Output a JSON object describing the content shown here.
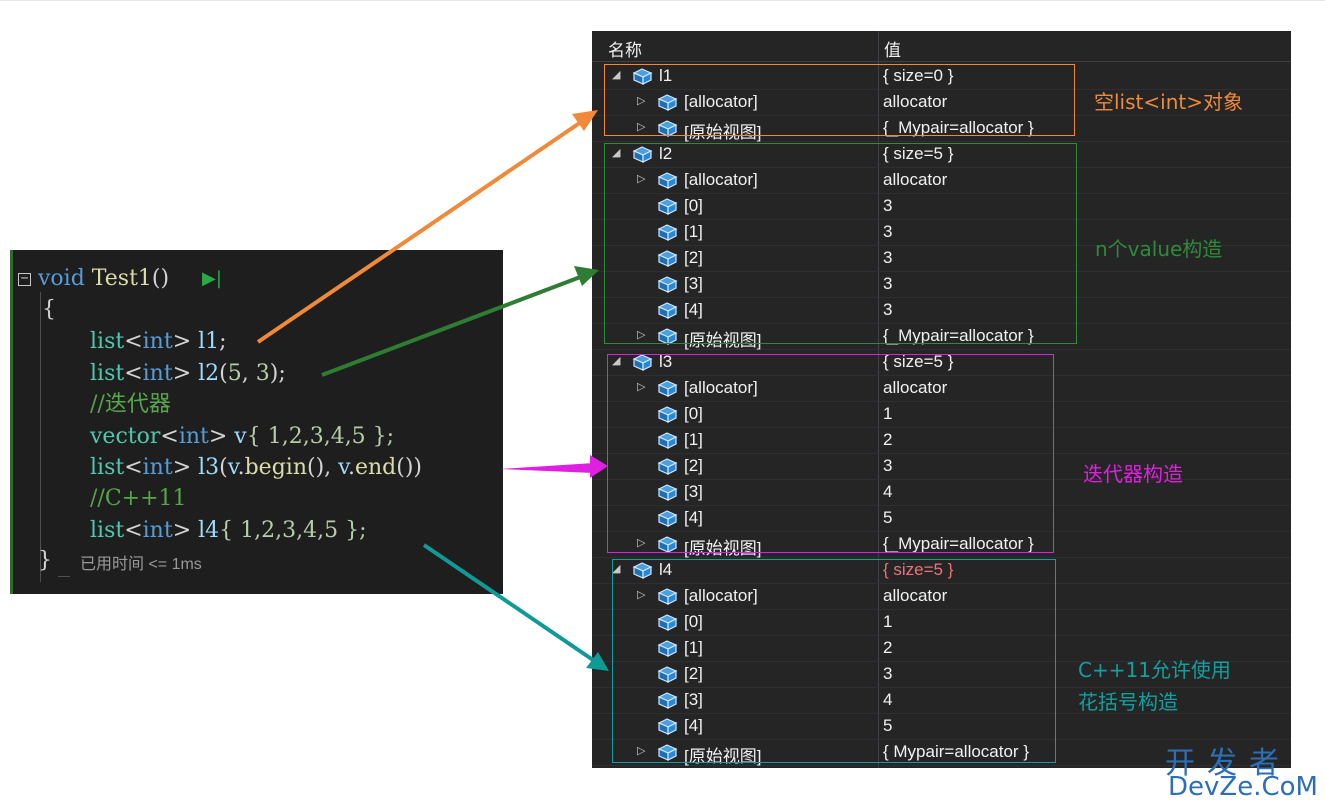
{
  "code": {
    "fold_symbol": "−",
    "line1": {
      "kw": "void",
      "fn": "Test1",
      "paren": "()",
      "run_glyph": "▶|"
    },
    "line2": "{",
    "line3": {
      "type": "list",
      "lt": "<",
      "arg": "int",
      "gt": ">",
      "var": "l1",
      "tail": ";"
    },
    "line4": {
      "type": "list",
      "lt": "<",
      "arg": "int",
      "gt": ">",
      "var": "l2",
      "open": "(",
      "n1": "5",
      "sep": ", ",
      "n2": "3",
      "tail": ");"
    },
    "line5": "//迭代器",
    "line6": {
      "type": "vector",
      "lt": "<",
      "arg": "int",
      "gt": ">",
      "var": "v",
      "body": "{ 1,2,3,4,5 };"
    },
    "line7": {
      "type": "list",
      "lt": "<",
      "arg": "int",
      "gt": ">",
      "var": "l3",
      "open": "(",
      "a": "v",
      "dot1": ".",
      "m1": "begin",
      "p1": "(), ",
      "b": "v",
      "dot2": ".",
      "m2": "end",
      "p2": "())"
    },
    "line8": "//C++11",
    "line9": {
      "type": "list",
      "lt": "<",
      "arg": "int",
      "gt": ">",
      "var": "l4",
      "body": "{ 1,2,3,4,5 };"
    },
    "line10": "}",
    "elapsed": "已用时间 <= 1ms"
  },
  "watch": {
    "col_name": "名称",
    "col_value": "值",
    "rows": [
      {
        "name": "l1",
        "value": "{ size=0 }",
        "expander": "◢"
      },
      {
        "name": "[allocator]",
        "value": "allocator",
        "expander": "▷"
      },
      {
        "name": "[原始视图]",
        "value": "{_Mypair=allocator }",
        "expander": "▷"
      },
      {
        "name": "l2",
        "value": "{ size=5 }",
        "expander": "◢"
      },
      {
        "name": "[allocator]",
        "value": "allocator",
        "expander": "▷"
      },
      {
        "name": "[0]",
        "value": "3",
        "expander": ""
      },
      {
        "name": "[1]",
        "value": "3",
        "expander": ""
      },
      {
        "name": "[2]",
        "value": "3",
        "expander": ""
      },
      {
        "name": "[3]",
        "value": "3",
        "expander": ""
      },
      {
        "name": "[4]",
        "value": "3",
        "expander": ""
      },
      {
        "name": "[原始视图]",
        "value": "{_Mypair=allocator }",
        "expander": "▷"
      },
      {
        "name": "l3",
        "value": "{ size=5 }",
        "expander": "◢"
      },
      {
        "name": "[allocator]",
        "value": "allocator",
        "expander": "▷"
      },
      {
        "name": "[0]",
        "value": "1",
        "expander": ""
      },
      {
        "name": "[1]",
        "value": "2",
        "expander": ""
      },
      {
        "name": "[2]",
        "value": "3",
        "expander": ""
      },
      {
        "name": "[3]",
        "value": "4",
        "expander": ""
      },
      {
        "name": "[4]",
        "value": "5",
        "expander": ""
      },
      {
        "name": "[原始视图]",
        "value": "{_Mypair=allocator }",
        "expander": "▷"
      },
      {
        "name": "l4",
        "value": "{ size=5 }",
        "expander": "◢",
        "changed": true
      },
      {
        "name": "[allocator]",
        "value": "allocator",
        "expander": "▷"
      },
      {
        "name": "[0]",
        "value": "1",
        "expander": ""
      },
      {
        "name": "[1]",
        "value": "2",
        "expander": ""
      },
      {
        "name": "[2]",
        "value": "3",
        "expander": ""
      },
      {
        "name": "[3]",
        "value": "4",
        "expander": ""
      },
      {
        "name": "[4]",
        "value": "5",
        "expander": ""
      },
      {
        "name": "[原始视图]",
        "value": "{ Mypair=allocator }",
        "expander": "▷"
      }
    ]
  },
  "annotations": {
    "a1": {
      "text": "空list<int>对象",
      "color": "#f08a3a"
    },
    "a2": {
      "text": "n个value构造",
      "color": "#2e8b3a"
    },
    "a3": {
      "text": "迭代器构造",
      "color": "#e020e0"
    },
    "a4_line1": "C++11允许使用",
    "a4_line2": "花括号构造",
    "a4_color": "#10a0a0"
  },
  "watermark": {
    "line1": "开发者",
    "line2": "DevZe.CoM",
    "color": "#2c6fb7"
  }
}
